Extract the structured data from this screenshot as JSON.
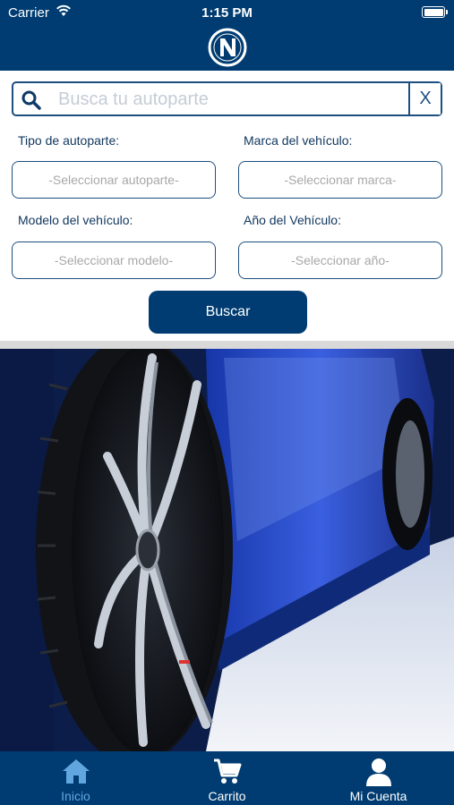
{
  "status_bar": {
    "carrier": "Carrier",
    "time": "1:15 PM"
  },
  "header": {
    "logo": "N"
  },
  "search": {
    "placeholder": "Busca tu autoparte",
    "value": "",
    "clear_label": "X"
  },
  "form": {
    "tipo_label": "Tipo de autoparte:",
    "tipo_value": "-Seleccionar autoparte-",
    "marca_label": "Marca del vehículo:",
    "marca_value": "-Seleccionar marca-",
    "modelo_label": "Modelo del vehículo:",
    "modelo_value": "-Seleccionar modelo-",
    "anio_label": "Año del Vehículo:",
    "anio_value": "-Seleccionar año-",
    "submit_label": "Buscar"
  },
  "tabs": [
    {
      "label": "Inicio",
      "icon": "home-icon",
      "active": true
    },
    {
      "label": "Carrito",
      "icon": "cart-icon",
      "active": false
    },
    {
      "label": "Mi Cuenta",
      "icon": "user-icon",
      "active": false
    }
  ],
  "colors": {
    "primary": "#003c71",
    "active_tab": "#62a6e0",
    "border": "#1d4f80"
  }
}
